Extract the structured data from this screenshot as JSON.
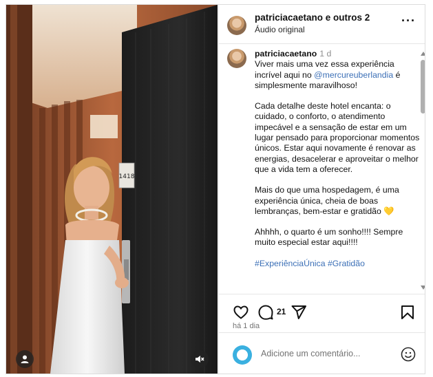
{
  "header": {
    "title": "patriciacaetano e outros 2",
    "subtitle": "Áudio original",
    "more_icon": "more-horizontal-icon"
  },
  "video": {
    "door_number": "1418",
    "user_icon": "user-icon",
    "mute_icon": "muted-speaker-icon"
  },
  "caption": {
    "username": "patriciacaetano",
    "time": "1 d",
    "p1_before": "Viver mais uma vez essa experiência incrível aqui no ",
    "p1_mention": "@mercureuberlandia",
    "p1_after": " é simplesmente maravilhoso!",
    "p2": "Cada detalhe deste hotel encanta: o cuidado, o conforto, o atendimento impecável e a sensação de estar em um lugar pensado para proporcionar momentos únicos. Estar aqui novamente é renovar as energias, desacelerar e aproveitar o melhor que a vida tem a oferecer.",
    "p3": "Mais do que uma hospedagem, é uma experiência única, cheia de boas lembranças, bem-estar e gratidão 💛",
    "p4": "Ahhhh, o quarto é um sonho!!!! Sempre muito especial estar aqui!!!!",
    "hashtags": "#ExperiênciaÚnica #Gratidão"
  },
  "actions": {
    "comment_count": "21",
    "age": "há 1 dia",
    "like_icon": "heart-icon",
    "comment_icon": "comment-icon",
    "share_icon": "share-icon",
    "save_icon": "bookmark-icon"
  },
  "compose": {
    "placeholder": "Adicione um comentário...",
    "emoji_icon": "emoji-icon"
  }
}
